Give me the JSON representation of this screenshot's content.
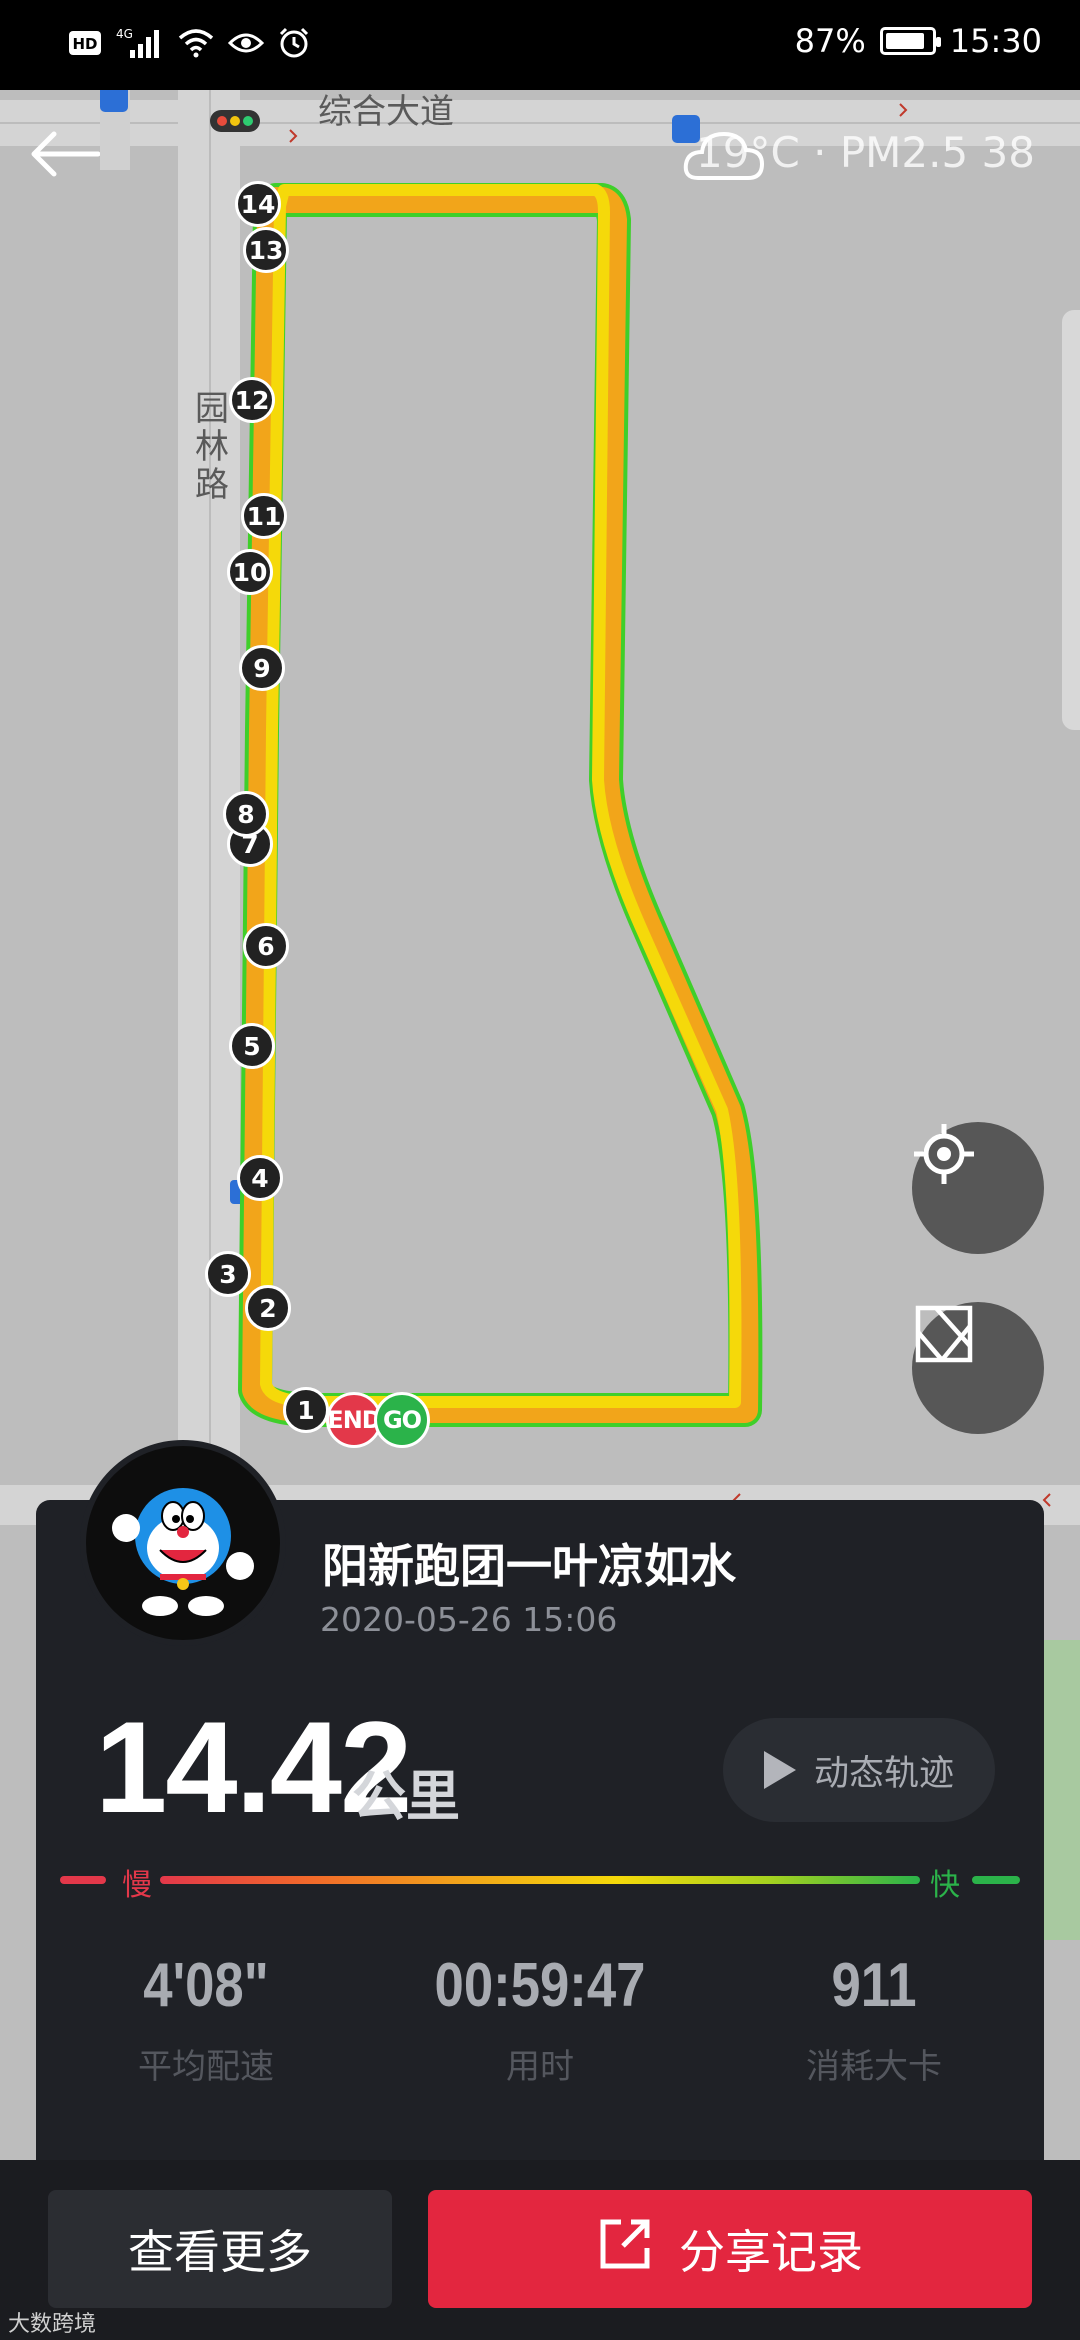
{
  "status_bar": {
    "left_icons": [
      "hd-icon",
      "signal-4g-icon",
      "wifi-icon",
      "eye-icon",
      "alarm-icon"
    ],
    "network_label": "HD",
    "network_type": "4G",
    "battery_percent": "87%",
    "battery_level": 0.87,
    "time": "15:30"
  },
  "map": {
    "road_top": "综合大道",
    "road_side": "园林路",
    "weather": "19°C · PM2.5 38",
    "km_markers": [
      "1",
      "2",
      "3",
      "4",
      "5",
      "6",
      "7",
      "8",
      "9",
      "10",
      "11",
      "12",
      "13",
      "14"
    ],
    "end_label": "END",
    "go_label": "GO"
  },
  "record": {
    "username": "阳新跑团一叶凉如水",
    "datetime": "2020-05-26 15:06",
    "distance": "14.42",
    "distance_unit": "公里",
    "replay_label": "动态轨迹",
    "speed_slow": "慢",
    "speed_fast": "快",
    "stats": [
      {
        "value": "4'08\"",
        "label": "平均配速"
      },
      {
        "value": "00:59:47",
        "label": "用时"
      },
      {
        "value": "911",
        "label": "消耗大卡"
      }
    ]
  },
  "actions": {
    "more": "查看更多",
    "share": "分享记录"
  },
  "watermark": "大数跨境",
  "colors": {
    "accent_red": "#e3263f",
    "card_bg": "#1f2126",
    "route_yellow": "#f5d90a",
    "route_orange": "#f2a51a",
    "route_green": "#3fcf2a"
  }
}
